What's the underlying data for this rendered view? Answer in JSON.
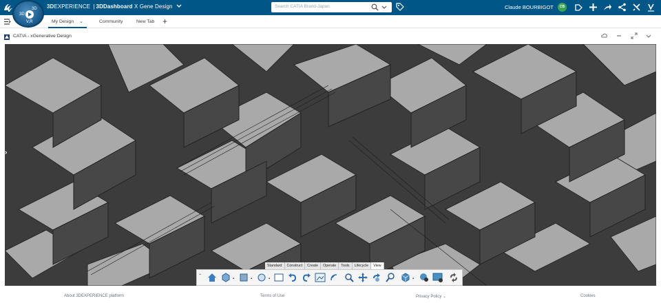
{
  "topbar": {
    "brand_3d": "3D",
    "brand_experience": "EXPERIENCE",
    "brand_separator": "|",
    "brand_app": "3DDashboard",
    "brand_dashboard": "X Gene Design",
    "search_placeholder": "Search CATIA Brand-Japan",
    "user_name": "Claude BOURBIGOT",
    "user_initials": "CB",
    "compass_north_east": "3D",
    "compass_west": "3D",
    "compass_south": "V,R",
    "colors": {
      "bar": "#005686",
      "avatar": "#3aa655"
    }
  },
  "tabs": [
    {
      "label": "My Design",
      "active": true
    },
    {
      "label": "Community",
      "active": false
    },
    {
      "label": "New Tab",
      "active": false
    }
  ],
  "widget": {
    "title": "CATIA - xGenerative Design"
  },
  "action_bar": {
    "tabs": [
      "Standard",
      "Construct",
      "Create",
      "Operate",
      "Tools",
      "Lifecycle",
      "View"
    ],
    "selected_tab": "View",
    "icons": [
      "home-view-icon",
      "view-mode-icon",
      "render-style-icon",
      "hide-show-icon",
      "view-selector-icon",
      "undo-icon",
      "redo-icon",
      "image-icon",
      "wireless-icon",
      "zoom-fit-icon",
      "pan-icon",
      "rotate-icon",
      "zoom-area-icon",
      "cube-view-icon",
      "capture-icon",
      "screen-capture-icon",
      "sync-icon"
    ]
  },
  "footer": {
    "about": "About 3DEXPERIENCE platform",
    "terms": "Terms of Use",
    "privacy": "Privacy Policy",
    "cookies": "Cookies"
  }
}
